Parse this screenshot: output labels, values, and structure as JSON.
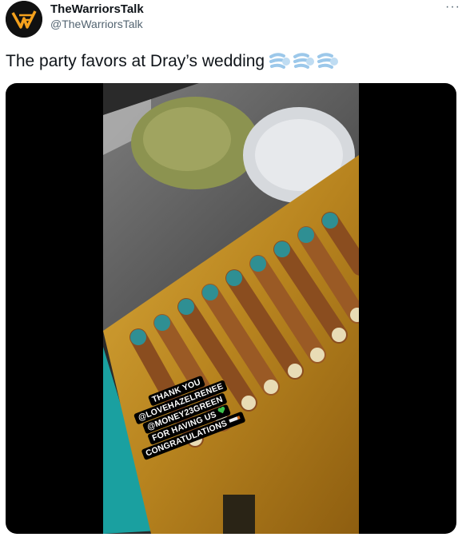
{
  "tweet": {
    "author": {
      "display_name": "TheWarriorsTalk",
      "handle": "@TheWarriorsTalk",
      "avatar_icon": "warriors-talk-logo-icon"
    },
    "more_icon": "more-options-icon",
    "text": "The party favors at Dray’s wedding",
    "emojis": [
      "dashing-away-icon",
      "dashing-away-icon",
      "dashing-away-icon"
    ],
    "media": {
      "story_caption": [
        "THANK YOU",
        "@LOVEHAZELRENEE",
        "@MONEY23GREEN",
        "FOR HAVING US",
        "CONGRATULATIONS"
      ],
      "caption_icons": [
        "green-heart-icon",
        "cigarette-icon"
      ]
    }
  },
  "colors": {
    "avatar_bg": "#111111",
    "avatar_accent": "#f4a11d",
    "handle_gray": "#536471",
    "tray_gold": "#b8841f",
    "teal": "#1aa0a0"
  }
}
